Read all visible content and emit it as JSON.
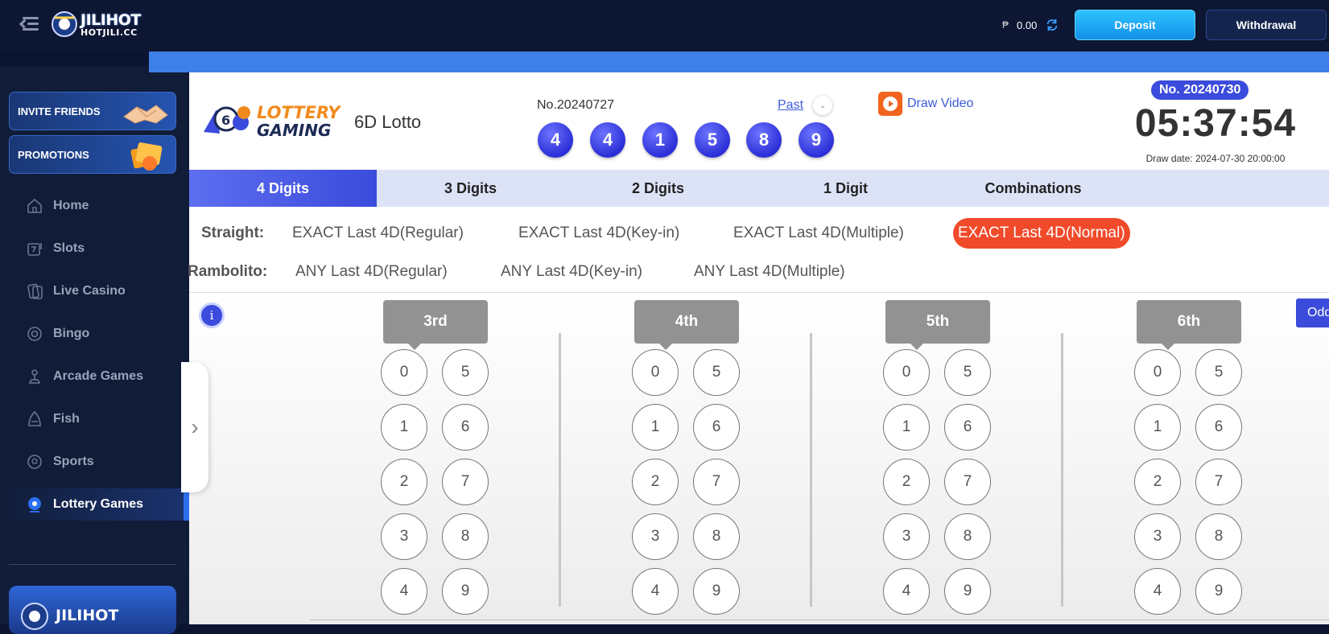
{
  "header": {
    "logo_line1": "JILIHOT",
    "logo_line2": "HOTJILI.CC",
    "currency_symbol": "₱",
    "balance": "0.00",
    "deposit_label": "Deposit",
    "withdrawal_label": "Withdrawal"
  },
  "sidebar": {
    "invite_label": "INVITE FRIENDS",
    "promotions_label": "PROMOTIONS",
    "items": [
      {
        "label": "Home",
        "icon": "home-icon"
      },
      {
        "label": "Slots",
        "icon": "slots-icon"
      },
      {
        "label": "Live Casino",
        "icon": "live-casino-icon"
      },
      {
        "label": "Bingo",
        "icon": "bingo-icon"
      },
      {
        "label": "Arcade Games",
        "icon": "arcade-icon"
      },
      {
        "label": "Fish",
        "icon": "fish-icon"
      },
      {
        "label": "Sports",
        "icon": "sports-icon"
      },
      {
        "label": "Lottery Games",
        "icon": "lottery-icon"
      }
    ],
    "active_item": "Lottery Games",
    "banner_label": "JILIHOT"
  },
  "game": {
    "brand_line1": "LOTTERY",
    "brand_line2": "GAMING",
    "title": "6D Lotto",
    "last_draw_no": "No.20240727",
    "past_label": "Past",
    "balls": [
      "4",
      "4",
      "1",
      "5",
      "8",
      "9"
    ],
    "draw_video_label": "Draw Video",
    "next_draw_no": "No. 20240730",
    "countdown": "05:37:54",
    "draw_date": "Draw date: 2024-07-30 20:00:00"
  },
  "tabs": [
    {
      "label": "4 Digits",
      "active": true
    },
    {
      "label": "3 Digits",
      "active": false
    },
    {
      "label": "2 Digits",
      "active": false
    },
    {
      "label": "1 Digit",
      "active": false
    },
    {
      "label": "Combinations",
      "active": false
    }
  ],
  "straight": {
    "label": "Straight:",
    "options": [
      "EXACT Last 4D(Regular)",
      "EXACT Last 4D(Key-in)",
      "EXACT Last 4D(Multiple)",
      "EXACT Last 4D(Normal)"
    ],
    "active": "EXACT Last 4D(Normal)"
  },
  "rambolito": {
    "label": "Rambolito:",
    "options": [
      "ANY Last 4D(Regular)",
      "ANY Last 4D(Key-in)",
      "ANY Last 4D(Multiple)"
    ]
  },
  "positions": [
    {
      "label": "3rd",
      "digits": [
        "0",
        "5",
        "1",
        "6",
        "2",
        "7",
        "3",
        "8",
        "4",
        "9"
      ]
    },
    {
      "label": "4th",
      "digits": [
        "0",
        "5",
        "1",
        "6",
        "2",
        "7",
        "3",
        "8",
        "4",
        "9"
      ]
    },
    {
      "label": "5th",
      "digits": [
        "0",
        "5",
        "1",
        "6",
        "2",
        "7",
        "3",
        "8",
        "4",
        "9"
      ]
    },
    {
      "label": "6th",
      "digits": [
        "0",
        "5",
        "1",
        "6",
        "2",
        "7",
        "3",
        "8",
        "4",
        "9"
      ]
    }
  ],
  "odds_label": "Odd",
  "info_label": "i",
  "colors": {
    "accent": "#3b4bdb",
    "active_option": "#f04a2a",
    "deposit": "#138fe8"
  }
}
